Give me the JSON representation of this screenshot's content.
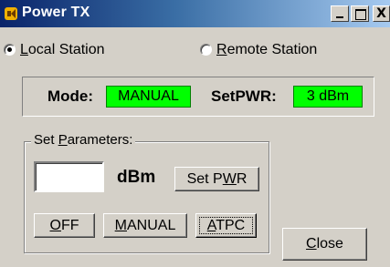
{
  "window": {
    "title": "Power TX",
    "controls": {
      "minimize": "_",
      "maximize": "□",
      "close": "X"
    }
  },
  "station": {
    "local": {
      "label": "Local Station",
      "checked": true
    },
    "remote": {
      "label": "Remote Station",
      "checked": false
    }
  },
  "status": {
    "mode_label": "Mode:",
    "mode_value": "MANUAL",
    "setpwr_label": "SetPWR:",
    "setpwr_value": "3 dBm",
    "indicator_color": "#00ff00"
  },
  "set_parameters": {
    "group_label": "Set Parameters:",
    "power_input_value": "",
    "unit": "dBm",
    "set_pwr_button": "Set PWR",
    "off_button": "OFF",
    "manual_button": "MANUAL",
    "atpc_button": "ATPC"
  },
  "close_button": "Close"
}
